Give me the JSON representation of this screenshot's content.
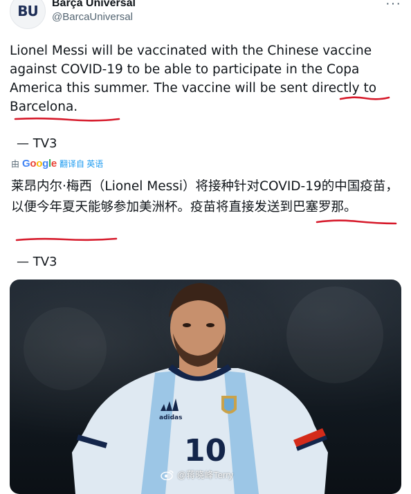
{
  "account": {
    "avatar_text": "BU",
    "display_name": "Barça Universal",
    "handle": "@BarcaUniversal"
  },
  "tweet": {
    "text_en": "Lionel Messi will be vaccinated with the Chinese vaccine against COVID-19 to be able to participate in the Copa America this summer. The vaccine will be sent directly to Barcelona.",
    "source_en": "— TV3",
    "translated_by_prefix": "由",
    "translator": "Google",
    "translated_by_suffix": "翻译自 英语",
    "text_zh": "莱昂内尔·梅西（Lionel Messi）将接种针对COVID-19的中国疫苗，以便今年夏天能够参加美洲杯。疫苗将直接发送到巴塞罗那。",
    "source_zh": "— TV3"
  },
  "media": {
    "jersey_number": "10",
    "brand": "adidas"
  },
  "watermark": {
    "text": "@蒋晓峰Terry",
    "icon": "weibo-icon"
  },
  "colors": {
    "annotation": "#d6192a",
    "link": "#1d9bf0",
    "text": "#0f1419",
    "muted": "#536471"
  },
  "icons": [
    "more-icon",
    "google-logo",
    "weibo-icon"
  ]
}
